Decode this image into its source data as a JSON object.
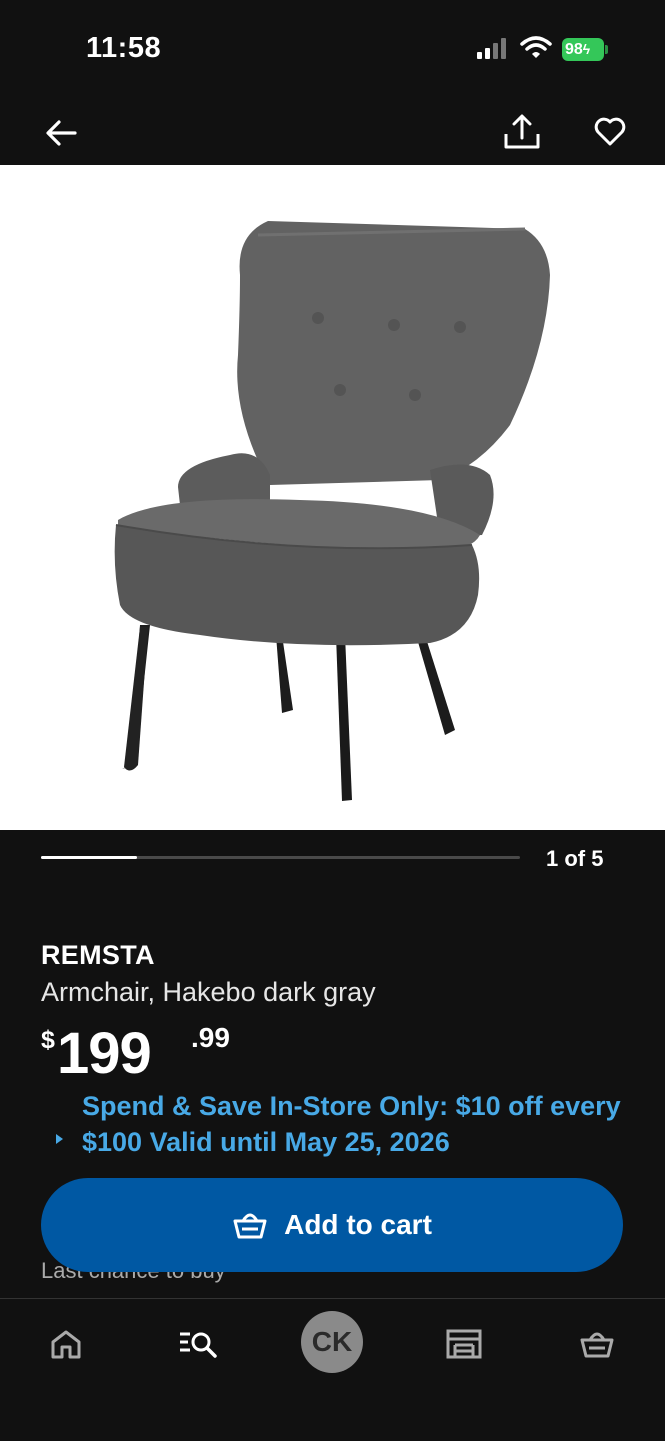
{
  "status_bar": {
    "time": "11:58",
    "battery": "98"
  },
  "nav": {
    "back_icon": "arrow-left-icon",
    "share_icon": "share-icon",
    "favorite_icon": "heart-icon"
  },
  "gallery": {
    "counter": "1 of 5",
    "current": 1,
    "total": 5,
    "progress_fraction": 0.2
  },
  "product": {
    "name": "REMSTA",
    "description": "Armchair, Hakebo dark gray",
    "price_currency": "$",
    "price_integer": "199",
    "price_decimal": ".99"
  },
  "promo": {
    "text": "Spend & Save In-Store Only: $10 off every $100 Valid until May 25, 2026"
  },
  "availability": {
    "note": "Last chance to buy"
  },
  "cta": {
    "label": "Add to cart",
    "icon": "shopping-basket-icon"
  },
  "tab_bar": {
    "items": [
      {
        "name": "home",
        "icon": "home-icon"
      },
      {
        "name": "search",
        "icon": "search-list-icon"
      },
      {
        "name": "profile",
        "initials": "CK"
      },
      {
        "name": "store",
        "icon": "store-icon"
      },
      {
        "name": "cart",
        "icon": "shopping-basket-icon"
      }
    ]
  },
  "colors": {
    "background": "#111111",
    "accent_blue": "#0058a3",
    "promo_blue": "#48a9e6",
    "battery_green": "#34c759"
  }
}
